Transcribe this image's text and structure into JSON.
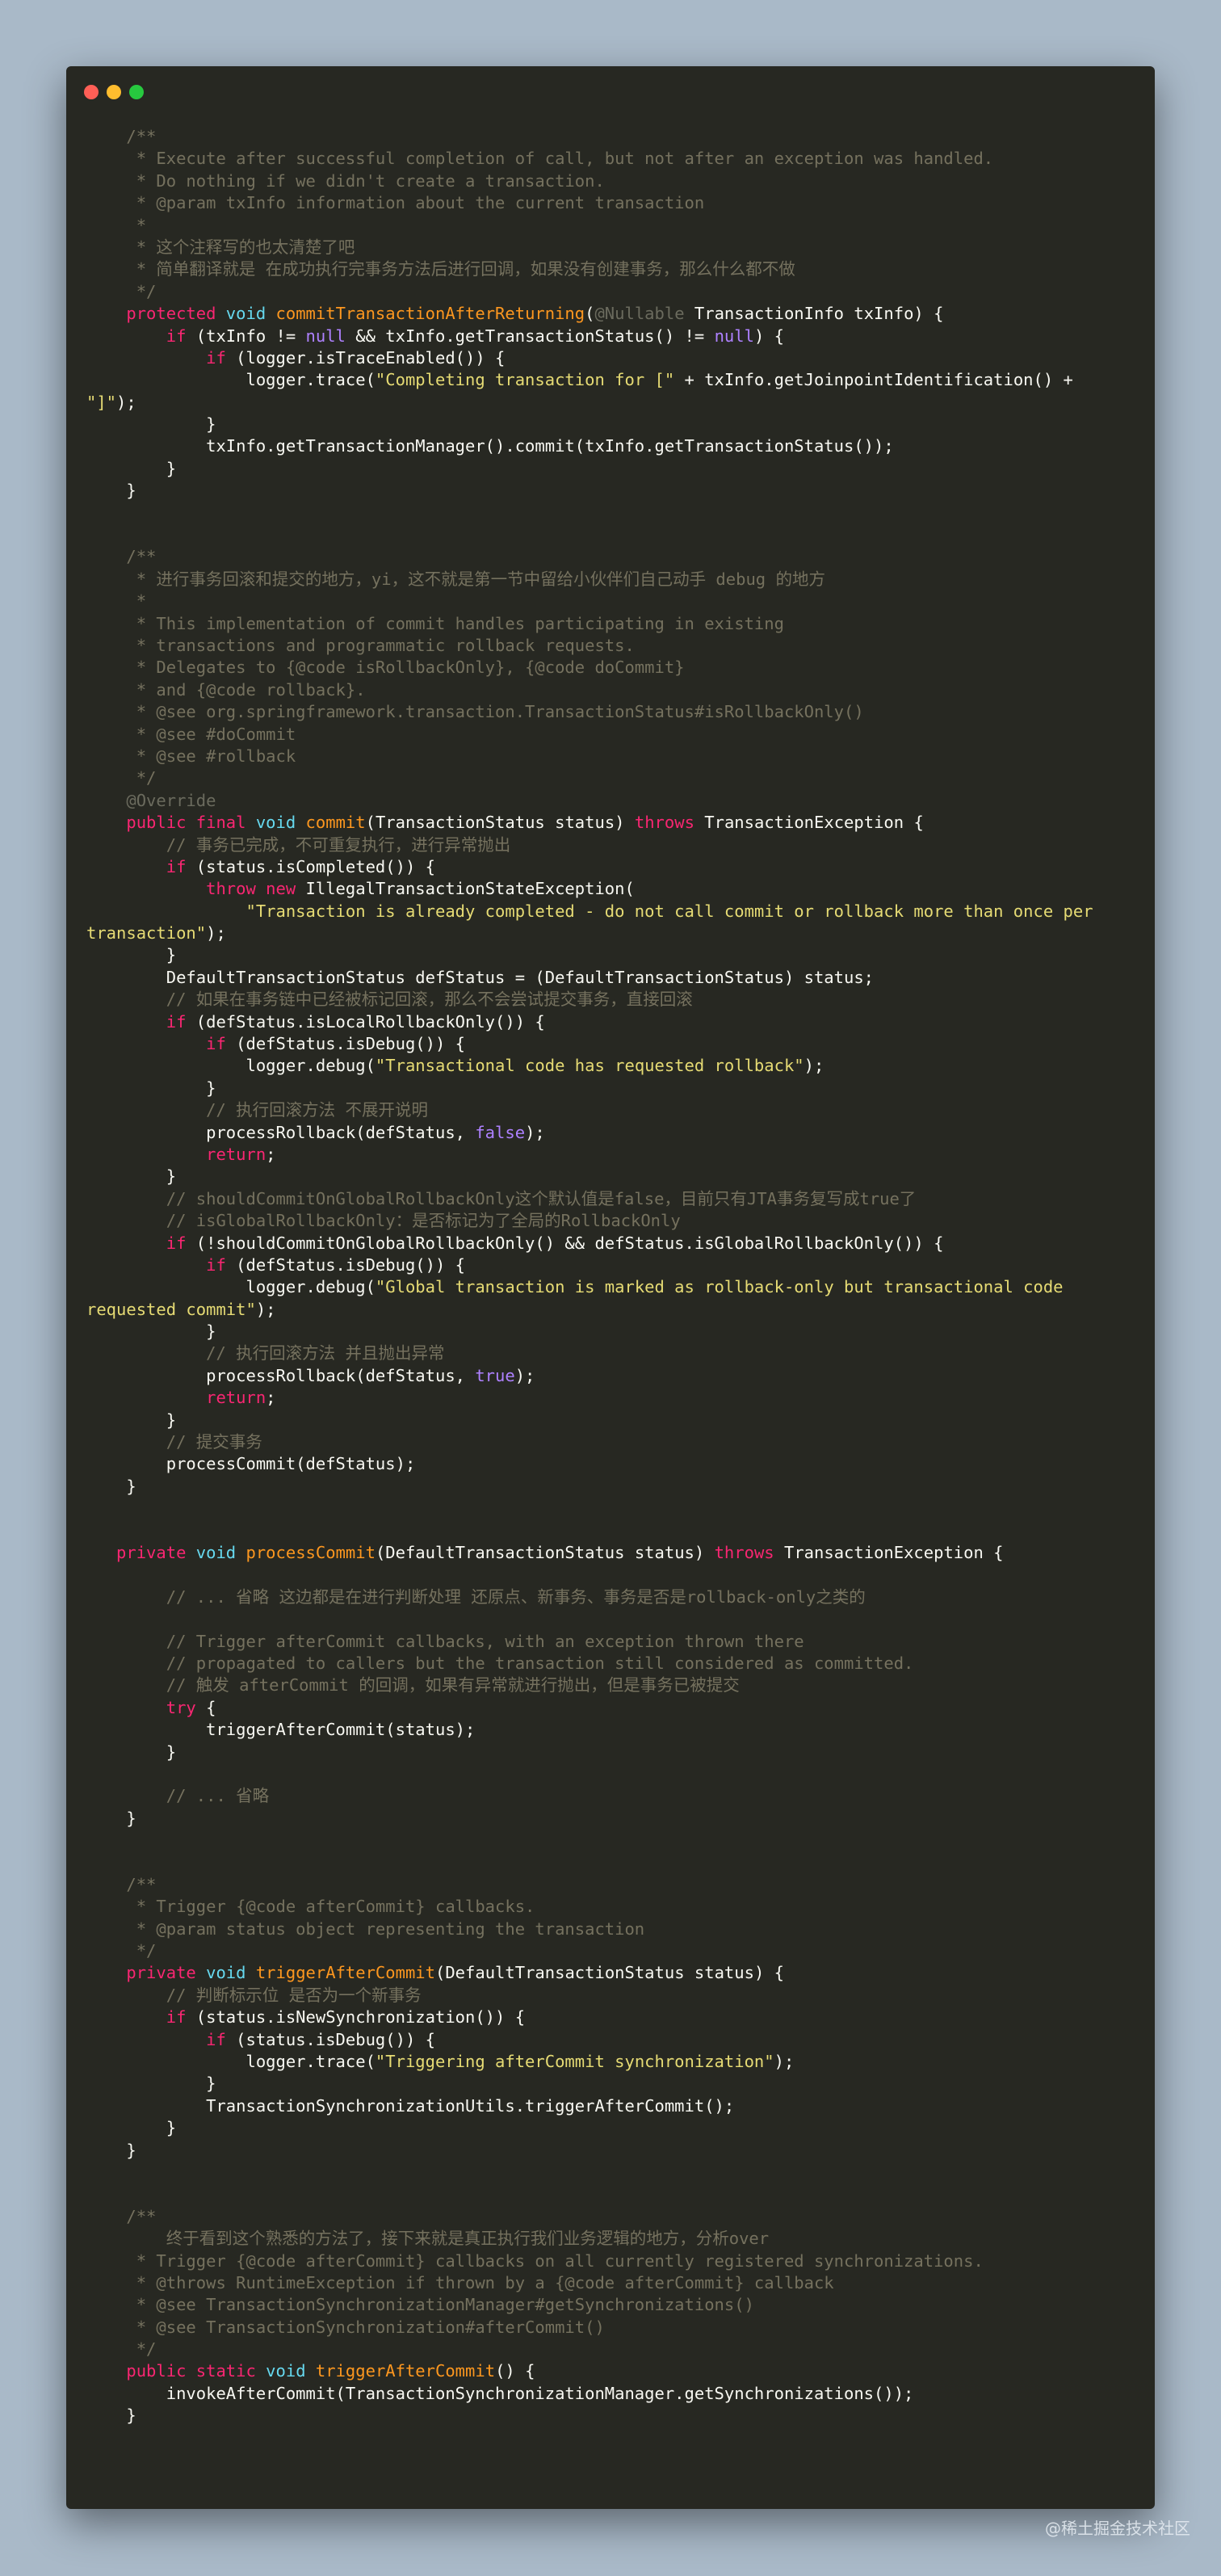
{
  "window": {
    "controls": [
      "close",
      "minimize",
      "maximize"
    ],
    "colors": {
      "background": "#272822",
      "close": "#ff5f56",
      "minimize": "#ffbd2e",
      "maximize": "#27c93f"
    }
  },
  "syntax_colors": {
    "comment": "#75715e",
    "keyword": "#f92672",
    "type": "#66d9ef",
    "function": "#fd971f",
    "string": "#e6db74",
    "literal": "#ae81ff",
    "plain": "#f8f8f2"
  },
  "code_lines": [
    [
      [
        "c",
        "    /**"
      ]
    ],
    [
      [
        "c",
        "     * Execute after successful completion of call, but not after an exception was handled."
      ]
    ],
    [
      [
        "c",
        "     * Do nothing if we didn't create a transaction."
      ]
    ],
    [
      [
        "c",
        "     * @param txInfo information about the current transaction"
      ]
    ],
    [
      [
        "c",
        "     *"
      ]
    ],
    [
      [
        "c",
        "     * 这个注释写的也太清楚了吧"
      ]
    ],
    [
      [
        "c",
        "     * 简单翻译就是 在成功执行完事务方法后进行回调，如果没有创建事务，那么什么都不做"
      ]
    ],
    [
      [
        "c",
        "     */"
      ]
    ],
    [
      [
        "k",
        "    protected "
      ],
      [
        "t",
        "void "
      ],
      [
        "f",
        "commitTransactionAfterReturning"
      ],
      [
        "p",
        "("
      ],
      [
        "a",
        "@Nullable "
      ],
      [
        "p",
        "TransactionInfo txInfo) {"
      ]
    ],
    [
      [
        "k",
        "        if "
      ],
      [
        "p",
        "(txInfo != "
      ],
      [
        "n",
        "null"
      ],
      [
        "p",
        " && txInfo.getTransactionStatus() != "
      ],
      [
        "n",
        "null"
      ],
      [
        "p",
        ") {"
      ]
    ],
    [
      [
        "k",
        "            if "
      ],
      [
        "p",
        "(logger.isTraceEnabled()) {"
      ]
    ],
    [
      [
        "p",
        "                logger.trace("
      ],
      [
        "s",
        "\"Completing transaction for [\""
      ],
      [
        "p",
        " + txInfo.getJoinpointIdentification() +"
      ]
    ],
    [
      [
        "s",
        "\"]\""
      ],
      [
        "p",
        ");"
      ]
    ],
    [
      [
        "p",
        "            }"
      ]
    ],
    [
      [
        "p",
        "            txInfo.getTransactionManager().commit(txInfo.getTransactionStatus());"
      ]
    ],
    [
      [
        "p",
        "        }"
      ]
    ],
    [
      [
        "p",
        "    }"
      ]
    ],
    [],
    [],
    [
      [
        "c",
        "    /**"
      ]
    ],
    [
      [
        "c",
        "     * 进行事务回滚和提交的地方，yi，这不就是第一节中留给小伙伴们自己动手 debug 的地方"
      ]
    ],
    [
      [
        "c",
        "     *"
      ]
    ],
    [
      [
        "c",
        "     * This implementation of commit handles participating in existing"
      ]
    ],
    [
      [
        "c",
        "     * transactions and programmatic rollback requests."
      ]
    ],
    [
      [
        "c",
        "     * Delegates to {@code isRollbackOnly}, {@code doCommit}"
      ]
    ],
    [
      [
        "c",
        "     * and {@code rollback}."
      ]
    ],
    [
      [
        "c",
        "     * @see org.springframework.transaction.TransactionStatus#isRollbackOnly()"
      ]
    ],
    [
      [
        "c",
        "     * @see #doCommit"
      ]
    ],
    [
      [
        "c",
        "     * @see #rollback"
      ]
    ],
    [
      [
        "c",
        "     */"
      ]
    ],
    [
      [
        "a",
        "    @Override"
      ]
    ],
    [
      [
        "k",
        "    public final "
      ],
      [
        "t",
        "void "
      ],
      [
        "f",
        "commit"
      ],
      [
        "p",
        "(TransactionStatus status) "
      ],
      [
        "k",
        "throws "
      ],
      [
        "p",
        "TransactionException {"
      ]
    ],
    [
      [
        "c",
        "        // 事务已完成，不可重复执行，进行异常抛出"
      ]
    ],
    [
      [
        "k",
        "        if "
      ],
      [
        "p",
        "(status.isCompleted()) {"
      ]
    ],
    [
      [
        "k",
        "            throw new "
      ],
      [
        "p",
        "IllegalTransactionStateException("
      ]
    ],
    [
      [
        "s",
        "                \"Transaction is already completed - do not call commit or rollback more than once per"
      ]
    ],
    [
      [
        "s",
        "transaction\""
      ],
      [
        "p",
        ");"
      ]
    ],
    [
      [
        "p",
        "        }"
      ]
    ],
    [
      [
        "p",
        "        DefaultTransactionStatus defStatus = (DefaultTransactionStatus) status;"
      ]
    ],
    [
      [
        "c",
        "        // 如果在事务链中已经被标记回滚，那么不会尝试提交事务，直接回滚"
      ]
    ],
    [
      [
        "k",
        "        if "
      ],
      [
        "p",
        "(defStatus.isLocalRollbackOnly()) {"
      ]
    ],
    [
      [
        "k",
        "            if "
      ],
      [
        "p",
        "(defStatus.isDebug()) {"
      ]
    ],
    [
      [
        "p",
        "                logger.debug("
      ],
      [
        "s",
        "\"Transactional code has requested rollback\""
      ],
      [
        "p",
        ");"
      ]
    ],
    [
      [
        "p",
        "            }"
      ]
    ],
    [
      [
        "c",
        "            // 执行回滚方法 不展开说明"
      ]
    ],
    [
      [
        "p",
        "            processRollback(defStatus, "
      ],
      [
        "n",
        "false"
      ],
      [
        "p",
        ");"
      ]
    ],
    [
      [
        "k",
        "            return"
      ],
      [
        "p",
        ";"
      ]
    ],
    [
      [
        "p",
        "        }"
      ]
    ],
    [
      [
        "c",
        "        // shouldCommitOnGlobalRollbackOnly这个默认值是false，目前只有JTA事务复写成true了"
      ]
    ],
    [
      [
        "c",
        "        // isGlobalRollbackOnly：是否标记为了全局的RollbackOnly"
      ]
    ],
    [
      [
        "k",
        "        if "
      ],
      [
        "p",
        "(!shouldCommitOnGlobalRollbackOnly() && defStatus.isGlobalRollbackOnly()) {"
      ]
    ],
    [
      [
        "k",
        "            if "
      ],
      [
        "p",
        "(defStatus.isDebug()) {"
      ]
    ],
    [
      [
        "p",
        "                logger.debug("
      ],
      [
        "s",
        "\"Global transaction is marked as rollback-only but transactional code"
      ]
    ],
    [
      [
        "s",
        "requested commit\""
      ],
      [
        "p",
        ");"
      ]
    ],
    [
      [
        "p",
        "            }"
      ]
    ],
    [
      [
        "c",
        "            // 执行回滚方法 并且抛出异常"
      ]
    ],
    [
      [
        "p",
        "            processRollback(defStatus, "
      ],
      [
        "n",
        "true"
      ],
      [
        "p",
        ");"
      ]
    ],
    [
      [
        "k",
        "            return"
      ],
      [
        "p",
        ";"
      ]
    ],
    [
      [
        "p",
        "        }"
      ]
    ],
    [
      [
        "c",
        "        // 提交事务"
      ]
    ],
    [
      [
        "p",
        "        processCommit(defStatus);"
      ]
    ],
    [
      [
        "p",
        "    }"
      ]
    ],
    [],
    [],
    [
      [
        "k",
        "   private "
      ],
      [
        "t",
        "void "
      ],
      [
        "f",
        "processCommit"
      ],
      [
        "p",
        "(DefaultTransactionStatus status) "
      ],
      [
        "k",
        "throws "
      ],
      [
        "p",
        "TransactionException {"
      ]
    ],
    [],
    [
      [
        "c",
        "        // ... 省略 这边都是在进行判断处理 还原点、新事务、事务是否是rollback-only之类的"
      ]
    ],
    [],
    [
      [
        "c",
        "        // Trigger afterCommit callbacks, with an exception thrown there"
      ]
    ],
    [
      [
        "c",
        "        // propagated to callers but the transaction still considered as committed."
      ]
    ],
    [
      [
        "c",
        "        // 触发 afterCommit 的回调，如果有异常就进行抛出，但是事务已被提交"
      ]
    ],
    [
      [
        "k",
        "        try "
      ],
      [
        "p",
        "{"
      ]
    ],
    [
      [
        "p",
        "            triggerAfterCommit(status);"
      ]
    ],
    [
      [
        "p",
        "        }"
      ]
    ],
    [],
    [
      [
        "c",
        "        // ... 省略"
      ]
    ],
    [
      [
        "p",
        "    }"
      ]
    ],
    [],
    [],
    [
      [
        "c",
        "    /**"
      ]
    ],
    [
      [
        "c",
        "     * Trigger {@code afterCommit} callbacks."
      ]
    ],
    [
      [
        "c",
        "     * @param status object representing the transaction"
      ]
    ],
    [
      [
        "c",
        "     */"
      ]
    ],
    [
      [
        "k",
        "    private "
      ],
      [
        "t",
        "void "
      ],
      [
        "f",
        "triggerAfterCommit"
      ],
      [
        "p",
        "(DefaultTransactionStatus status) {"
      ]
    ],
    [
      [
        "c",
        "        // 判断标示位 是否为一个新事务"
      ]
    ],
    [
      [
        "k",
        "        if "
      ],
      [
        "p",
        "(status.isNewSynchronization()) {"
      ]
    ],
    [
      [
        "k",
        "            if "
      ],
      [
        "p",
        "(status.isDebug()) {"
      ]
    ],
    [
      [
        "p",
        "                logger.trace("
      ],
      [
        "s",
        "\"Triggering afterCommit synchronization\""
      ],
      [
        "p",
        ");"
      ]
    ],
    [
      [
        "p",
        "            }"
      ]
    ],
    [
      [
        "p",
        "            TransactionSynchronizationUtils.triggerAfterCommit();"
      ]
    ],
    [
      [
        "p",
        "        }"
      ]
    ],
    [
      [
        "p",
        "    }"
      ]
    ],
    [],
    [],
    [
      [
        "c",
        "    /**"
      ]
    ],
    [
      [
        "c",
        "        终于看到这个熟悉的方法了，接下来就是真正执行我们业务逻辑的地方，分析over"
      ]
    ],
    [
      [
        "c",
        "     * Trigger {@code afterCommit} callbacks on all currently registered synchronizations."
      ]
    ],
    [
      [
        "c",
        "     * @throws RuntimeException if thrown by a {@code afterCommit} callback"
      ]
    ],
    [
      [
        "c",
        "     * @see TransactionSynchronizationManager#getSynchronizations()"
      ]
    ],
    [
      [
        "c",
        "     * @see TransactionSynchronization#afterCommit()"
      ]
    ],
    [
      [
        "c",
        "     */"
      ]
    ],
    [
      [
        "k",
        "    public static "
      ],
      [
        "t",
        "void "
      ],
      [
        "f",
        "triggerAfterCommit"
      ],
      [
        "p",
        "() {"
      ]
    ],
    [
      [
        "p",
        "        invokeAfterCommit(TransactionSynchronizationManager.getSynchronizations());"
      ]
    ],
    [
      [
        "p",
        "    }"
      ]
    ]
  ],
  "watermark": "@稀土掘金技术社区"
}
